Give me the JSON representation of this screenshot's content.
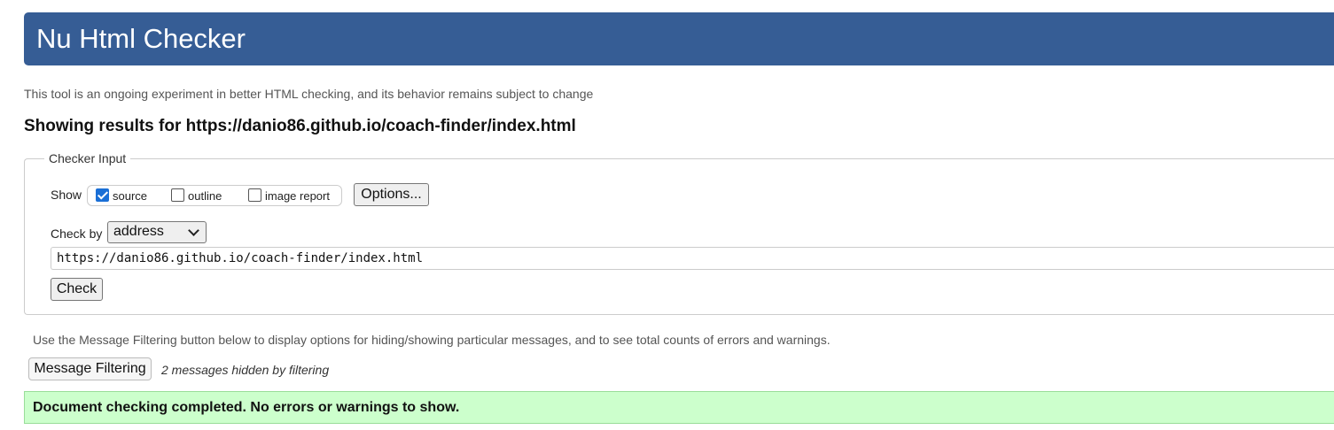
{
  "header": {
    "title": "Nu Html Checker"
  },
  "intro": "This tool is an ongoing experiment in better HTML checking, and its behavior remains subject to change",
  "results_heading": "Showing results for https://danio86.github.io/coach-finder/index.html",
  "checker_input": {
    "legend": "Checker Input",
    "show_label": "Show",
    "show_options": [
      {
        "label": "source",
        "checked": true
      },
      {
        "label": "outline",
        "checked": false
      },
      {
        "label": "image report",
        "checked": false
      }
    ],
    "options_button": "Options...",
    "check_by_label": "Check by",
    "check_by_value": "address",
    "url_value": "https://danio86.github.io/coach-finder/index.html",
    "check_button": "Check"
  },
  "filtering": {
    "info": "Use the Message Filtering button below to display options for hiding/showing particular messages, and to see total counts of errors and warnings.",
    "button": "Message Filtering",
    "hidden_count": "2 messages hidden by filtering"
  },
  "result": {
    "message": "Document checking completed. No errors or warnings to show."
  },
  "colors": {
    "header_bg": "#365d95",
    "success_bg": "#ccffcc",
    "checkbox_accent": "#1a6fd6"
  }
}
